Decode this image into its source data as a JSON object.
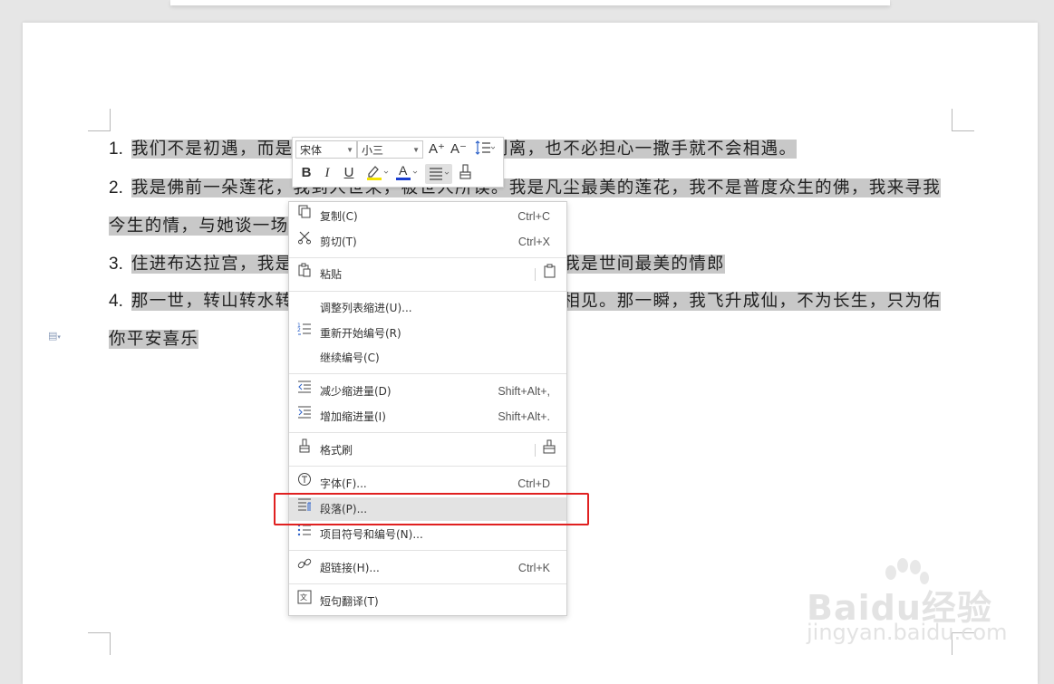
{
  "document": {
    "lines": [
      {
        "num": "1.",
        "text": "我们不是初遇，而是久别重逢。所以不必害怕别离，也不必担心一撒手就不会相遇。"
      },
      {
        "num": "2.",
        "text": "我是佛前一朵莲花，我到人世来，被世人所误。我是凡尘最美的莲花，我不是普度众生的佛，我来寻我"
      },
      {
        "num": "",
        "text": "今生的情，与她谈一场生死恋爱。"
      },
      {
        "num": "3.",
        "text": "住进布达拉宫，我是雪域最大的王。流浪在拉萨街头，我是世间最美的情郎"
      },
      {
        "num": "4.",
        "text": "那一世，转山转水转佛塔，不为修来世，只为途中与你相见。那一瞬，我飞升成仙，不为长生，只为佑"
      },
      {
        "num": "",
        "text": "你平安喜乐"
      }
    ]
  },
  "mini_toolbar": {
    "font_name": "宋体",
    "font_size": "小三",
    "grow_font": "A⁺",
    "shrink_font": "A⁻",
    "line_spacing_icon": "line-spacing-icon",
    "bold": "B",
    "italic": "I",
    "underline": "U",
    "highlight": "✎",
    "font_color": "A",
    "align": "☰",
    "format_painter": "♙",
    "highlight_color": "#f5e400",
    "font_color_bar": "#1a3fd1"
  },
  "context_menu": {
    "items": [
      {
        "label": "复制(C)",
        "shortcut": "Ctrl+C",
        "icon": "copy-icon"
      },
      {
        "label": "剪切(T)",
        "shortcut": "Ctrl+X",
        "icon": "cut-icon"
      },
      {
        "label": "粘贴",
        "shortcut": "",
        "icon": "paste-icon"
      },
      {
        "label": "调整列表缩进(U)...",
        "shortcut": "",
        "icon": ""
      },
      {
        "label": "重新开始编号(R)",
        "shortcut": "",
        "icon": "restart-numbering-icon"
      },
      {
        "label": "继续编号(C)",
        "shortcut": "",
        "icon": ""
      },
      {
        "label": "减少缩进量(D)",
        "shortcut": "Shift+Alt+,",
        "icon": "decrease-indent-icon"
      },
      {
        "label": "增加缩进量(I)",
        "shortcut": "Shift+Alt+.",
        "icon": "increase-indent-icon"
      },
      {
        "label": "格式刷",
        "shortcut": "",
        "icon": "format-painter-icon"
      },
      {
        "label": "字体(F)...",
        "shortcut": "Ctrl+D",
        "icon": "font-icon"
      },
      {
        "label": "段落(P)...",
        "shortcut": "",
        "icon": "paragraph-icon"
      },
      {
        "label": "项目符号和编号(N)...",
        "shortcut": "",
        "icon": "bullets-numbering-icon"
      },
      {
        "label": "超链接(H)...",
        "shortcut": "Ctrl+K",
        "icon": "hyperlink-icon"
      },
      {
        "label": "短句翻译(T)",
        "shortcut": "",
        "icon": "translate-icon"
      }
    ]
  },
  "watermark": {
    "brand": "Baidu经验",
    "url": "jingyan.baidu.com"
  },
  "colors": {
    "selection": "#c8c8c8",
    "highlight_box": "#e02020",
    "hover_item": "#e3e3e3"
  }
}
